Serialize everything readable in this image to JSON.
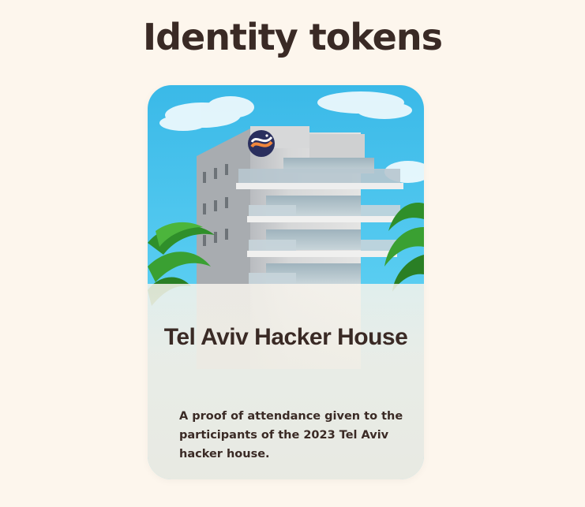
{
  "heading": "Identity tokens",
  "token_card": {
    "title": "Tel Aviv Hacker House",
    "description": "A proof of attendance given to the participants of the 2023 Tel Aviv hacker house.",
    "image_icon": "hacker-house-building-image"
  },
  "colors": {
    "background": "#fdf6ed",
    "text": "#3a2a25",
    "sky": "#4cc6ee"
  }
}
